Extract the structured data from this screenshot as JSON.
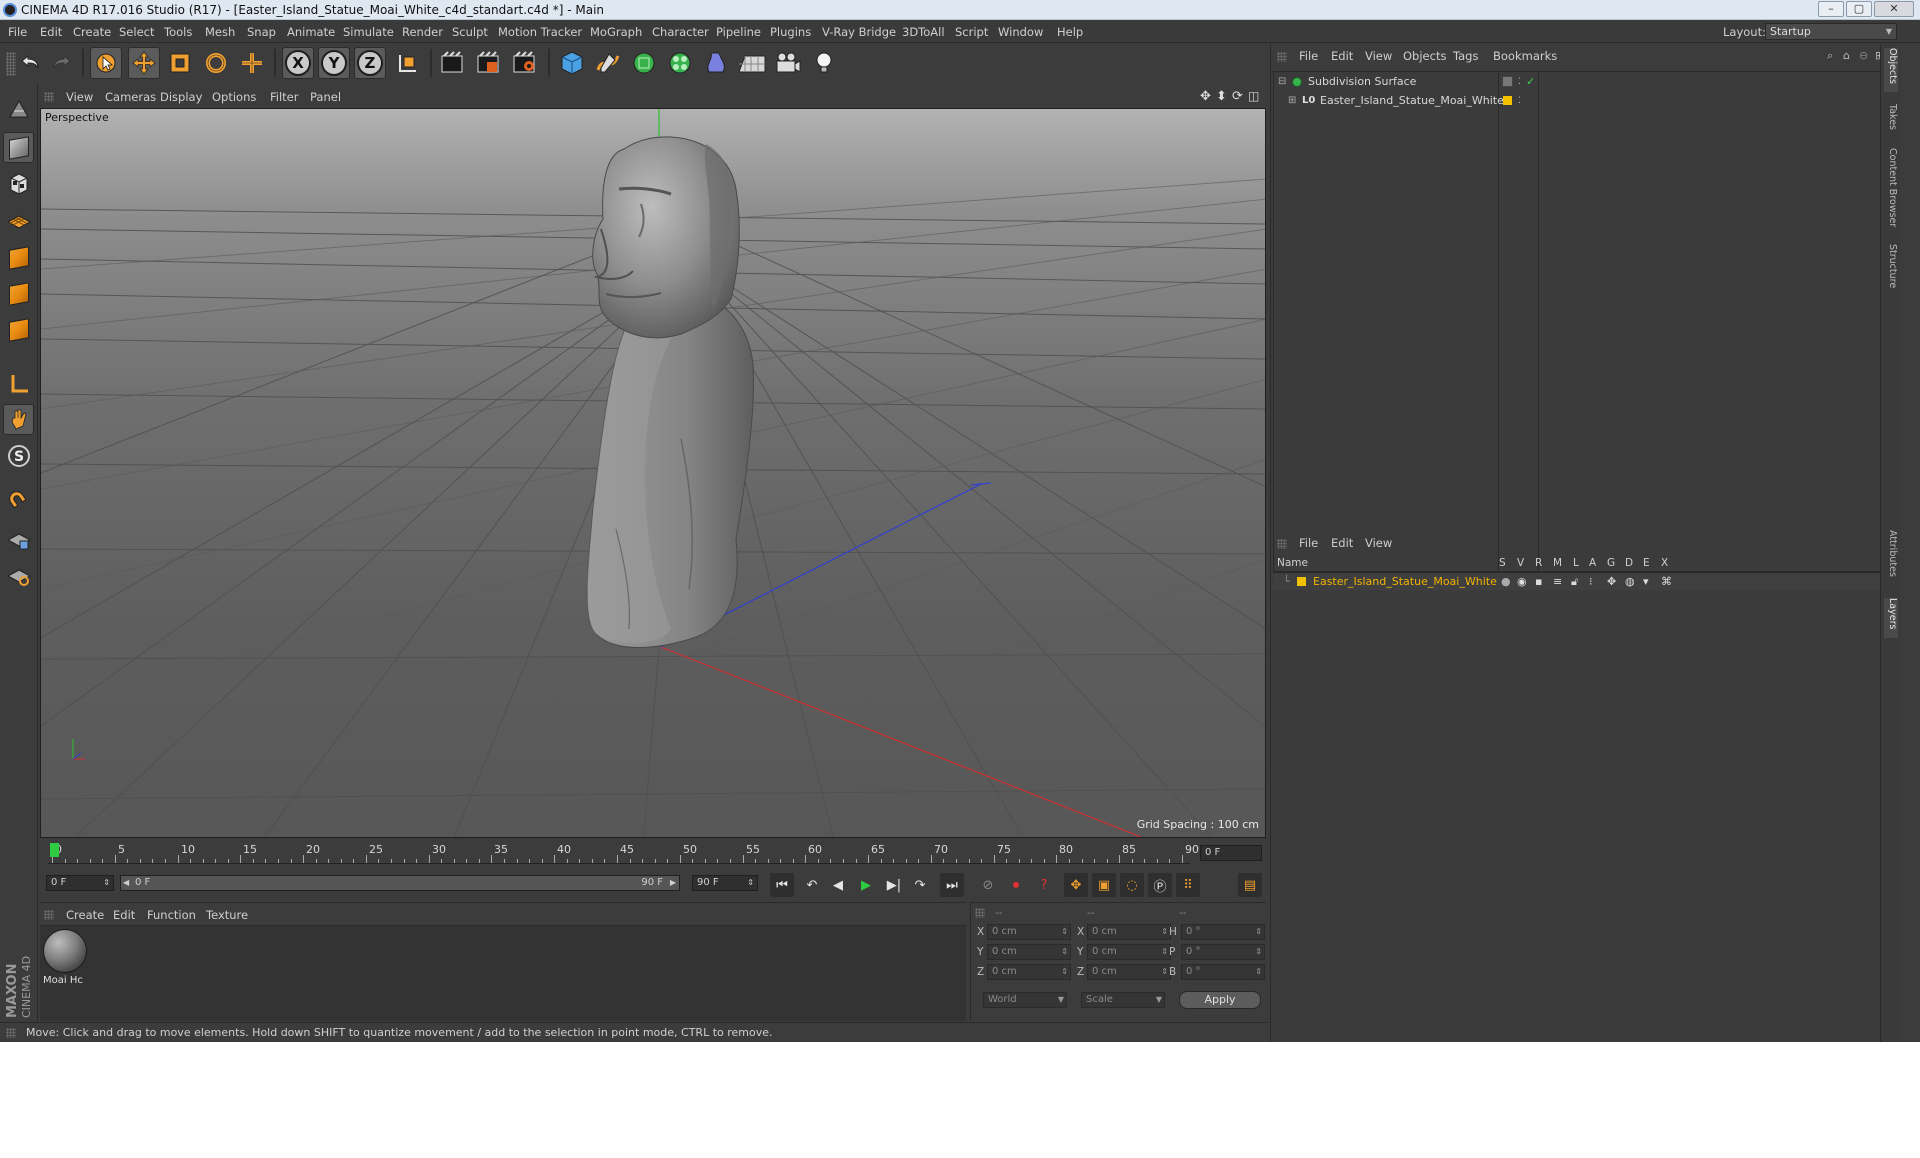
{
  "window": {
    "title": "CINEMA 4D R17.016 Studio (R17) - [Easter_Island_Statue_Moai_White_c4d_standart.c4d *] - Main",
    "buttons": [
      "–",
      "▢",
      "✕"
    ]
  },
  "menubar": {
    "items": [
      "File",
      "Edit",
      "Create",
      "Select",
      "Tools",
      "Mesh",
      "Snap",
      "Animate",
      "Simulate",
      "Render",
      "Sculpt",
      "Motion Tracker",
      "MoGraph",
      "Character",
      "Pipeline",
      "Plugins",
      "V-Ray Bridge",
      "3DToAll",
      "Script",
      "Window",
      "Help"
    ],
    "layout_label": "Layout:",
    "layout_value": "Startup"
  },
  "toolbar": {
    "icons": [
      "undo-icon",
      "redo-icon",
      "select-arrow-icon",
      "move-icon",
      "scale-icon",
      "rotate-icon",
      "last-tool-icon",
      "x-axis-icon",
      "y-axis-icon",
      "z-axis-icon",
      "world-coords-icon",
      "render-view-icon",
      "render-picture-icon",
      "render-settings-icon",
      "cube-primitive-icon",
      "pen-spline-icon",
      "subdivision-icon",
      "cloner-icon",
      "deformer-icon",
      "floor-icon",
      "camera-icon",
      "light-icon"
    ],
    "axis_labels": [
      "X",
      "Y",
      "Z"
    ]
  },
  "viewport": {
    "menu": [
      "View",
      "Cameras",
      "Display",
      "Options",
      "Filter",
      "Panel"
    ],
    "label": "Perspective",
    "grid_spacing": "Grid Spacing : 100 cm"
  },
  "timeline": {
    "ticks": [
      "0",
      "5",
      "10",
      "15",
      "20",
      "25",
      "30",
      "35",
      "40",
      "45",
      "50",
      "55",
      "60",
      "65",
      "70",
      "75",
      "80",
      "85",
      "90"
    ],
    "current_frame_display": "0 F",
    "start_field": "0 F",
    "range_start": "0 F",
    "range_end": "90 F",
    "end_field": "90 F"
  },
  "material_manager": {
    "menu": [
      "Create",
      "Edit",
      "Function",
      "Texture"
    ],
    "materials": [
      {
        "name": "Moai Hc"
      }
    ]
  },
  "coordinates": {
    "headers": [
      "--",
      "--",
      "--"
    ],
    "rows": [
      {
        "l1": "X",
        "v1": "0 cm",
        "l2": "X",
        "v2": "0 cm",
        "l3": "H",
        "v3": "0 °"
      },
      {
        "l1": "Y",
        "v1": "0 cm",
        "l2": "Y",
        "v2": "0 cm",
        "l3": "P",
        "v3": "0 °"
      },
      {
        "l1": "Z",
        "v1": "0 cm",
        "l2": "Z",
        "v2": "0 cm",
        "l3": "B",
        "v3": "0 °"
      }
    ],
    "mode_world": "World",
    "mode_scale": "Scale",
    "apply": "Apply"
  },
  "status": {
    "text": "Move: Click and drag to move elements. Hold down SHIFT to quantize movement / add to the selection in point mode, CTRL to remove."
  },
  "object_manager": {
    "menu": [
      "File",
      "Edit",
      "View",
      "Objects",
      "Tags",
      "Bookmarks"
    ],
    "objects": [
      {
        "name": "Subdivision Surface",
        "icon": "subdivision-surface-icon"
      },
      {
        "name": "Easter_Island_Statue_Moai_White",
        "icon": "polygon-object-icon"
      }
    ]
  },
  "layer_manager": {
    "menu": [
      "File",
      "Edit",
      "View"
    ],
    "columns": [
      "Name",
      "S",
      "V",
      "R",
      "M",
      "L",
      "A",
      "G",
      "D",
      "E",
      "X"
    ],
    "layers": [
      {
        "name": "Easter_Island_Statue_Moai_White",
        "color": "#f2c200"
      }
    ]
  },
  "side_tabs": [
    "Objects",
    "Takes",
    "Content Browser",
    "Structure",
    "Attributes",
    "Layers"
  ],
  "colors": {
    "accent_orange": "#f0a030",
    "layer_yellow": "#f2c200",
    "play_green": "#2ecc40",
    "record_red": "#e03030",
    "axis_x": "#d03030",
    "axis_z": "#3040d0",
    "axis_y": "#30c030"
  },
  "logo": "MAXON CINEMA 4D"
}
